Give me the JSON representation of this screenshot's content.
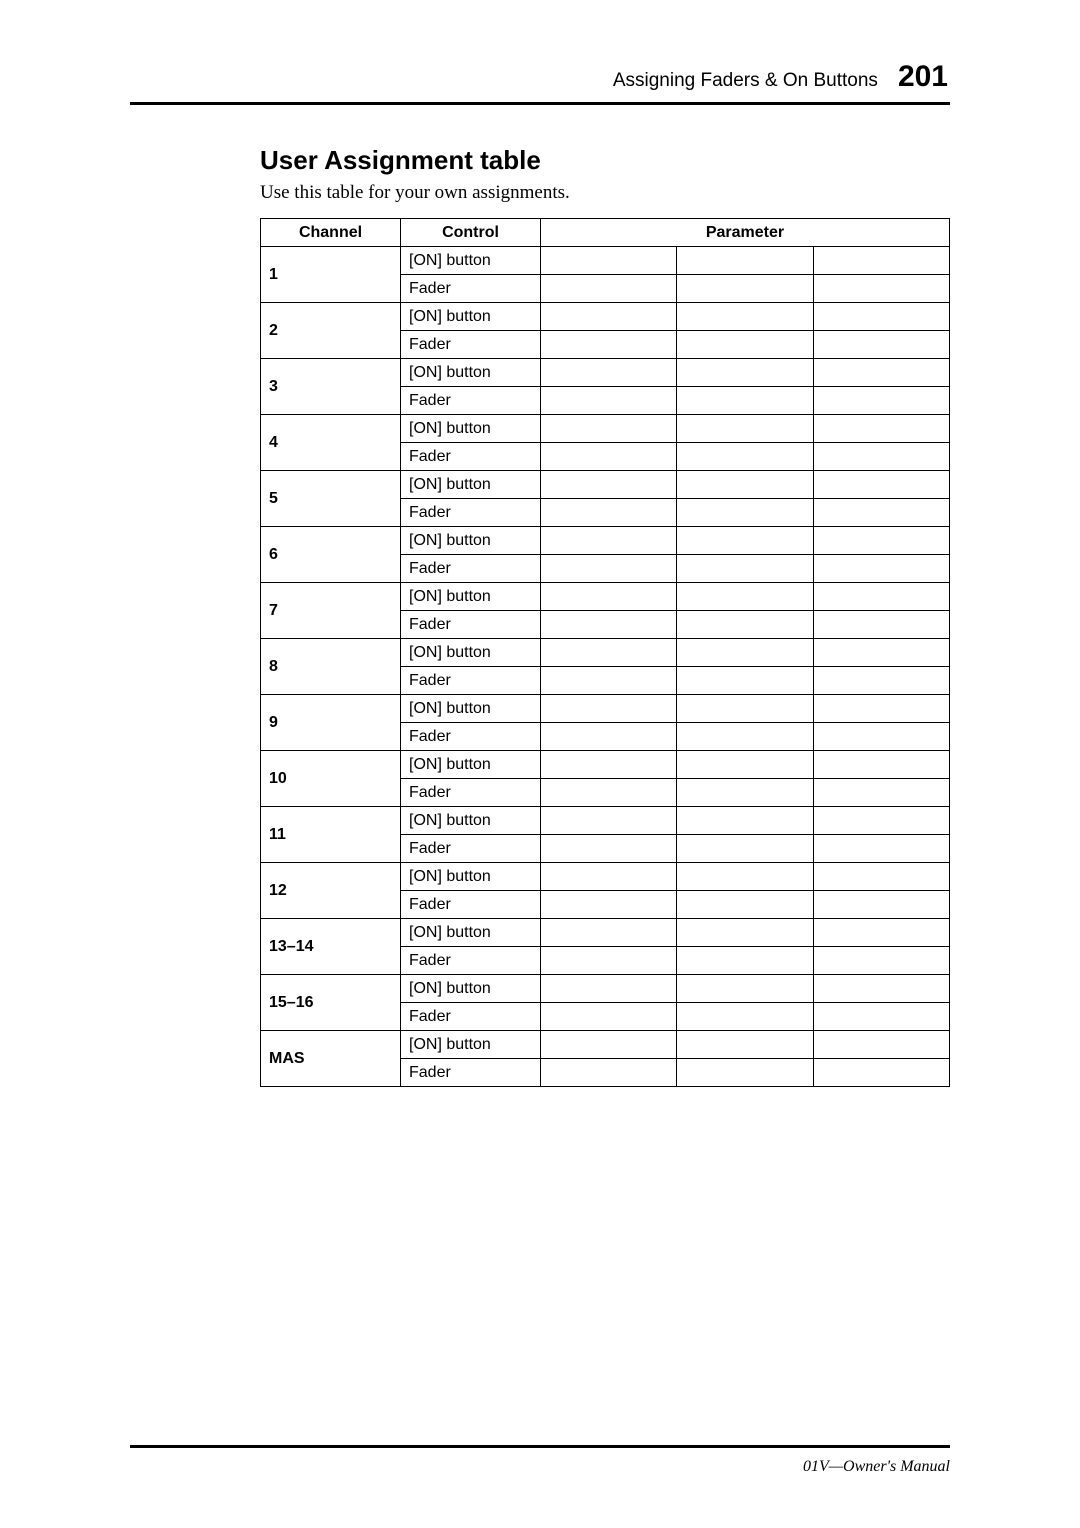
{
  "header": {
    "section": "Assigning Faders & On Buttons",
    "page": "201"
  },
  "section": {
    "title": "User Assignment table",
    "intro": "Use this table for your own assignments."
  },
  "table": {
    "headers": {
      "channel": "Channel",
      "control": "Control",
      "parameter": "Parameter"
    },
    "control_on": "[ON] button",
    "control_fader": "Fader",
    "channels": [
      "1",
      "2",
      "3",
      "4",
      "5",
      "6",
      "7",
      "8",
      "9",
      "10",
      "11",
      "12",
      "13–14",
      "15–16",
      "MAS"
    ]
  },
  "footer": "01V—Owner's Manual"
}
